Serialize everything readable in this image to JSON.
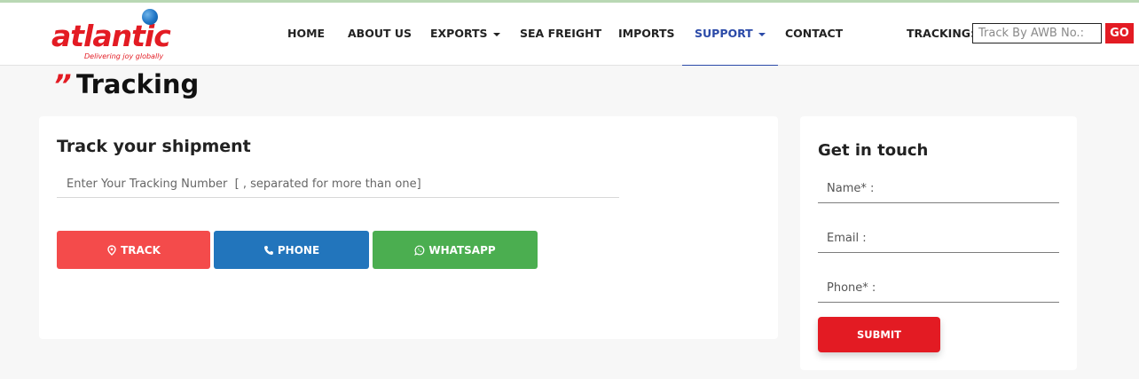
{
  "brand": {
    "name": "atlantic",
    "tagline": "Delivering joy globally",
    "color": "#e31b23"
  },
  "nav": {
    "items": [
      {
        "label": "HOME",
        "has_caret": false,
        "active": false
      },
      {
        "label": "ABOUT US",
        "has_caret": false,
        "active": false
      },
      {
        "label": "EXPORTS",
        "has_caret": true,
        "active": false
      },
      {
        "label": "SEA FREIGHT",
        "has_caret": false,
        "active": false
      },
      {
        "label": "IMPORTS",
        "has_caret": false,
        "active": false
      },
      {
        "label": "SUPPORT",
        "has_caret": true,
        "active": true
      },
      {
        "label": "CONTACT",
        "has_caret": false,
        "active": false
      }
    ],
    "active_color": "#2b4aa8"
  },
  "header_tracking": {
    "label": "TRACKING:",
    "placeholder": "Track By AWB No.:",
    "value": "",
    "go_label": "GO"
  },
  "page": {
    "quote_mark": "”",
    "title": "Tracking"
  },
  "tracker": {
    "title": "Track your shipment",
    "input_placeholder": "Enter Your Tracking Number  [ , separated for more than one]",
    "input_value": "",
    "buttons": {
      "track": {
        "label": "TRACK",
        "icon": "map-pin-icon",
        "color": "#f44b4b"
      },
      "phone": {
        "label": "PHONE",
        "icon": "phone-icon",
        "color": "#2275bc"
      },
      "whatsapp": {
        "label": "WHATSAPP",
        "icon": "whatsapp-icon",
        "color": "#4bae50"
      }
    }
  },
  "contact_form": {
    "title": "Get in touch",
    "name_placeholder": "Name* :",
    "email_placeholder": "Email :",
    "phone_placeholder": "Phone* :",
    "submit_label": "SUBMIT"
  }
}
